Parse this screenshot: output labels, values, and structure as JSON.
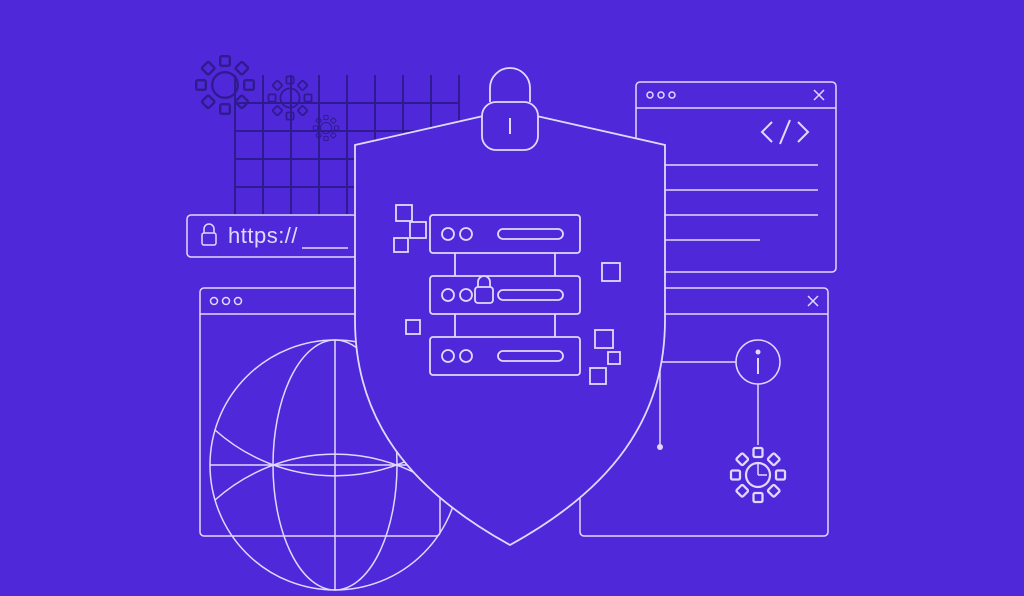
{
  "illustration": {
    "background_color": "#4F29D9",
    "line_color": "#E0D9FF",
    "grid_color": "#2F1B8F",
    "address_bar": {
      "protocol_label": "https://",
      "icon": "lock-icon"
    },
    "shield": {
      "icon": "padlock-icon",
      "servers": 3
    },
    "code_window": {
      "icon": "code-brackets-icon",
      "lines": 4
    },
    "info_window": {
      "icon": "info-icon",
      "gear_icon": "gear-icon"
    },
    "globe_window": {
      "icon": "globe-icon"
    },
    "decorative": {
      "gears": 3,
      "grid_pattern": true
    }
  }
}
